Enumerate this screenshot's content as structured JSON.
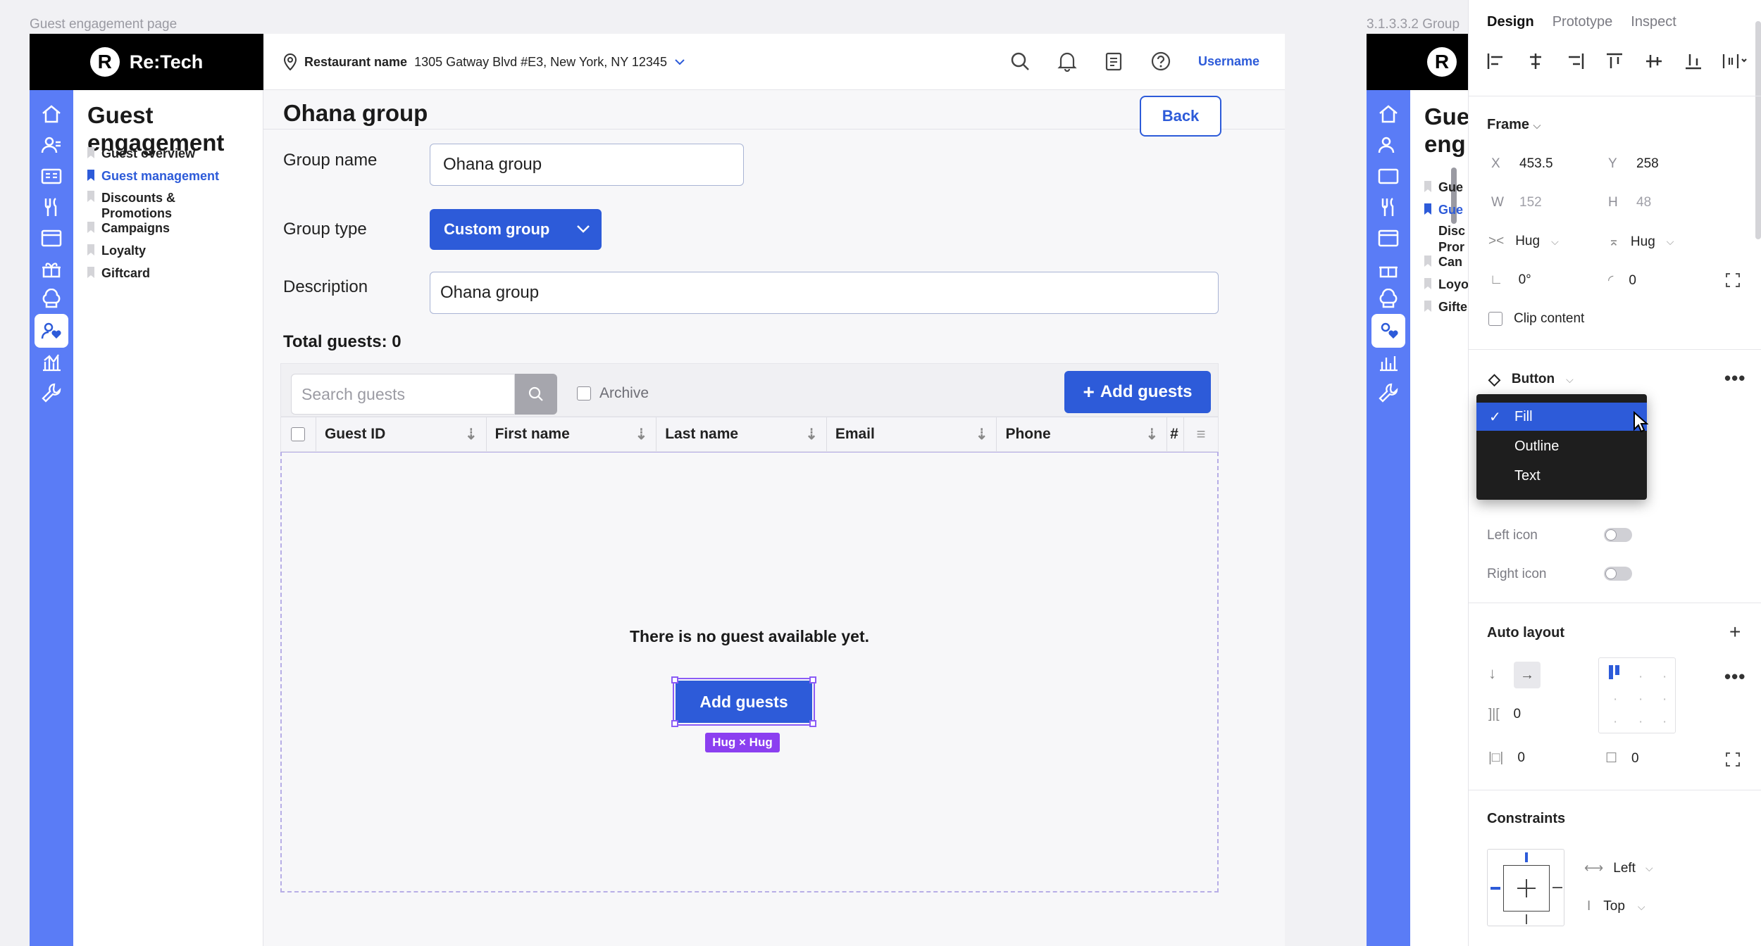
{
  "frames": {
    "main_label": "Guest engagement page",
    "right_label": "3.1.3.3.2 Group"
  },
  "brand": {
    "name": "Re:Tech",
    "mark": "R"
  },
  "topbar": {
    "restaurant_label": "Restaurant name",
    "address": "1305 Gatway Blvd #E3, New York, NY 12345",
    "username": "Username"
  },
  "sidebar": {
    "title": "Guest engagement",
    "items": [
      {
        "label": "Guest overview"
      },
      {
        "label": "Guest management"
      },
      {
        "label": "Discounts & Promotions"
      },
      {
        "label": "Campaigns"
      },
      {
        "label": "Loyalty"
      },
      {
        "label": "Giftcard"
      }
    ],
    "rail_icons": [
      "home-icon",
      "users-icon",
      "id-card-icon",
      "utensils-icon",
      "browser-icon",
      "gift-box-icon",
      "chef-hat-icon",
      "guest-heart-icon",
      "chart-icon",
      "wrench-icon"
    ]
  },
  "right_frame_sidebar": {
    "title_fragment_1": "Gue",
    "title_fragment_2": "eng",
    "items": [
      "Gue",
      "Gue",
      "Disc",
      "Pror",
      "Can",
      "Loyo",
      "Gifte"
    ]
  },
  "page": {
    "title": "Ohana group",
    "back_label": "Back",
    "group_name_label": "Group name",
    "group_name_value": "Ohana group",
    "group_type_label": "Group type",
    "group_type_value": "Custom group",
    "description_label": "Description",
    "description_value": "Ohana group",
    "total_guests": "Total guests: 0"
  },
  "table": {
    "search_placeholder": "Search guests",
    "archive_label": "Archive",
    "add_label": "Add guests",
    "columns": [
      "Guest ID",
      "First name",
      "Last name",
      "Email",
      "Phone",
      "#"
    ],
    "empty_message": "There is no guest available yet.",
    "empty_button": "Add guests",
    "size_tag": "Hug × Hug"
  },
  "panel": {
    "tabs": [
      "Design",
      "Prototype",
      "Inspect"
    ],
    "frame_title": "Frame",
    "x_label": "X",
    "x": "453.5",
    "y_label": "Y",
    "y": "258",
    "w_label": "W",
    "w": "152",
    "h_label": "H",
    "h": "48",
    "hug_w": "Hug",
    "hug_h": "Hug",
    "rotation": "0°",
    "radius": "0",
    "clip_content": "Clip content",
    "component": "Button",
    "variant_options": [
      "Fill",
      "Outline",
      "Text"
    ],
    "variant_selected": "Fill",
    "left_icon": "Left icon",
    "right_icon": "Right icon",
    "auto_layout": "Auto layout",
    "gap": "0",
    "padding_h": "0",
    "padding_v": "0",
    "constraints": "Constraints",
    "constraint_h": "Left",
    "constraint_v": "Top"
  },
  "colors": {
    "primary": "#2d5bd9",
    "rail": "#5a7cf6",
    "selection": "#8b5cf6"
  }
}
